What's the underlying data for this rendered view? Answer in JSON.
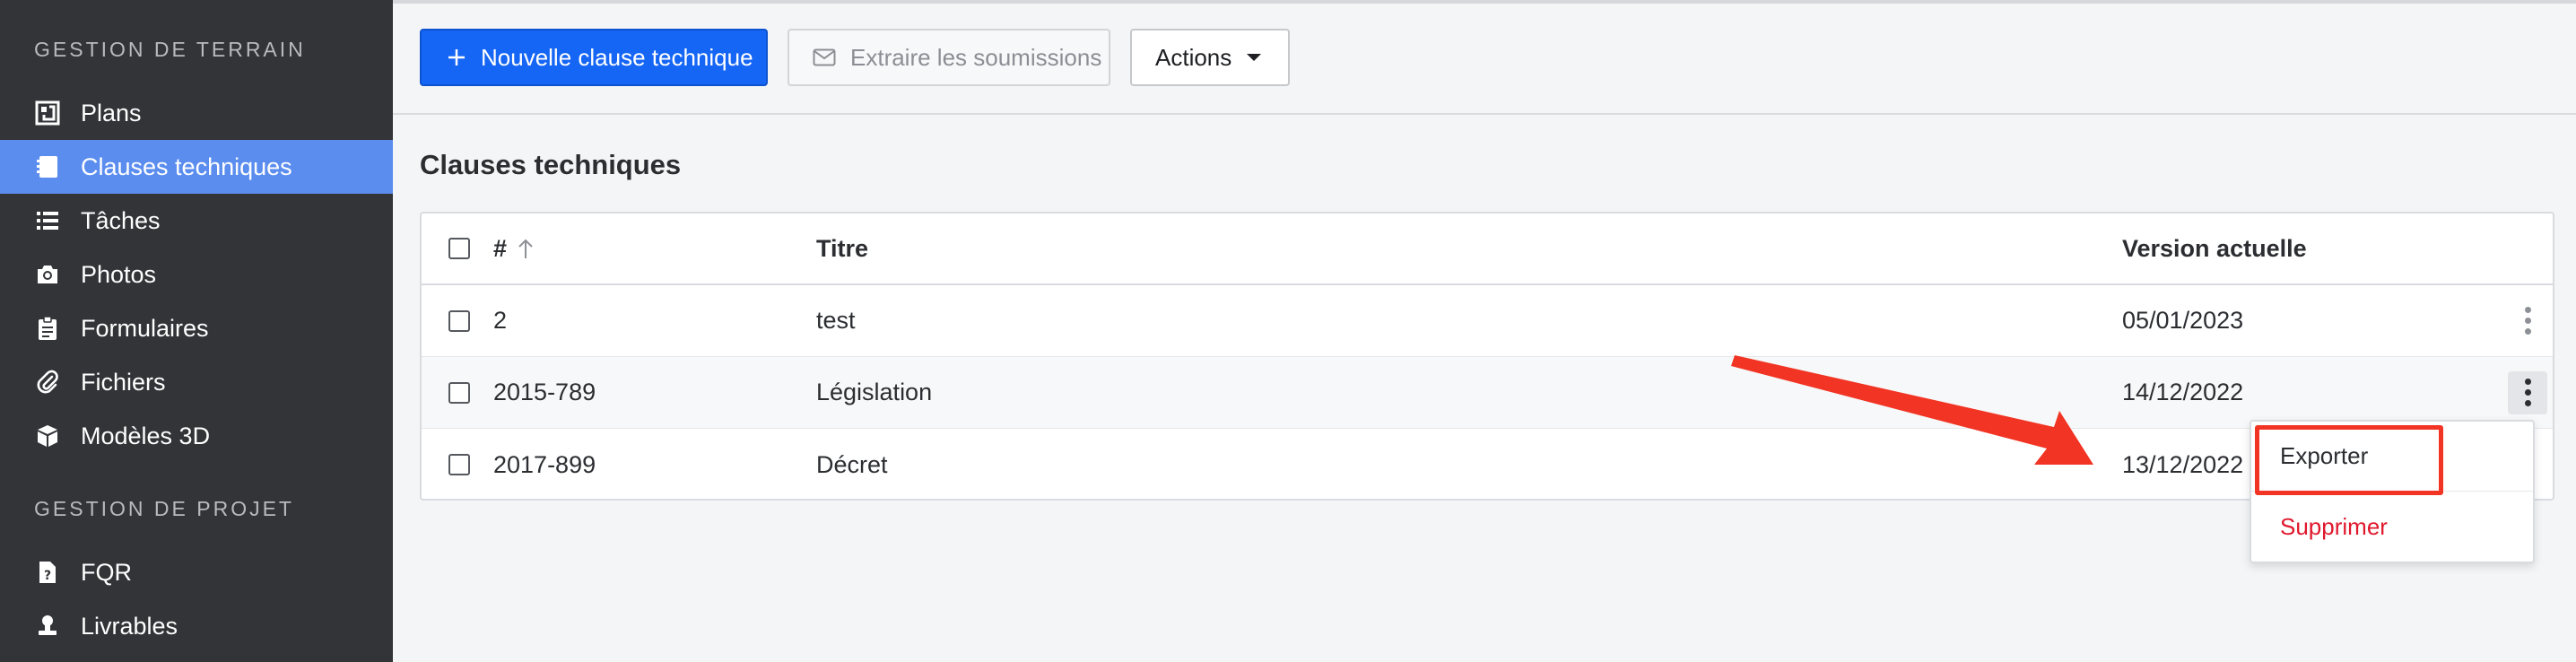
{
  "sidebar": {
    "section1": "GESTION DE TERRAIN",
    "section2": "GESTION DE PROJET",
    "items": [
      {
        "label": "Plans",
        "icon": "plans-icon"
      },
      {
        "label": "Clauses techniques",
        "icon": "notebook-icon"
      },
      {
        "label": "Tâches",
        "icon": "list-icon"
      },
      {
        "label": "Photos",
        "icon": "camera-icon"
      },
      {
        "label": "Formulaires",
        "icon": "clipboard-icon"
      },
      {
        "label": "Fichiers",
        "icon": "paperclip-icon"
      },
      {
        "label": "Modèles 3D",
        "icon": "cube-icon"
      },
      {
        "label": "FQR",
        "icon": "file-question-icon"
      },
      {
        "label": "Livrables",
        "icon": "stamp-icon"
      }
    ]
  },
  "toolbar": {
    "new_label": "Nouvelle clause technique",
    "extract_label": "Extraire les soumissions",
    "actions_label": "Actions"
  },
  "page_title": "Clauses techniques",
  "table": {
    "headers": {
      "num": "#",
      "title": "Titre",
      "version": "Version actuelle"
    },
    "rows": [
      {
        "num": "2",
        "title": "test",
        "version": "05/01/2023"
      },
      {
        "num": "2015-789",
        "title": "Législation",
        "version": "14/12/2022"
      },
      {
        "num": "2017-899",
        "title": "Décret",
        "version": "13/12/2022"
      }
    ]
  },
  "menu": {
    "export_label": "Exporter",
    "delete_label": "Supprimer"
  },
  "colors": {
    "sidebar_bg": "#333438",
    "active_item": "#5b8def",
    "primary": "#1666f5",
    "danger": "#e0182d",
    "annotation": "#f13423"
  }
}
